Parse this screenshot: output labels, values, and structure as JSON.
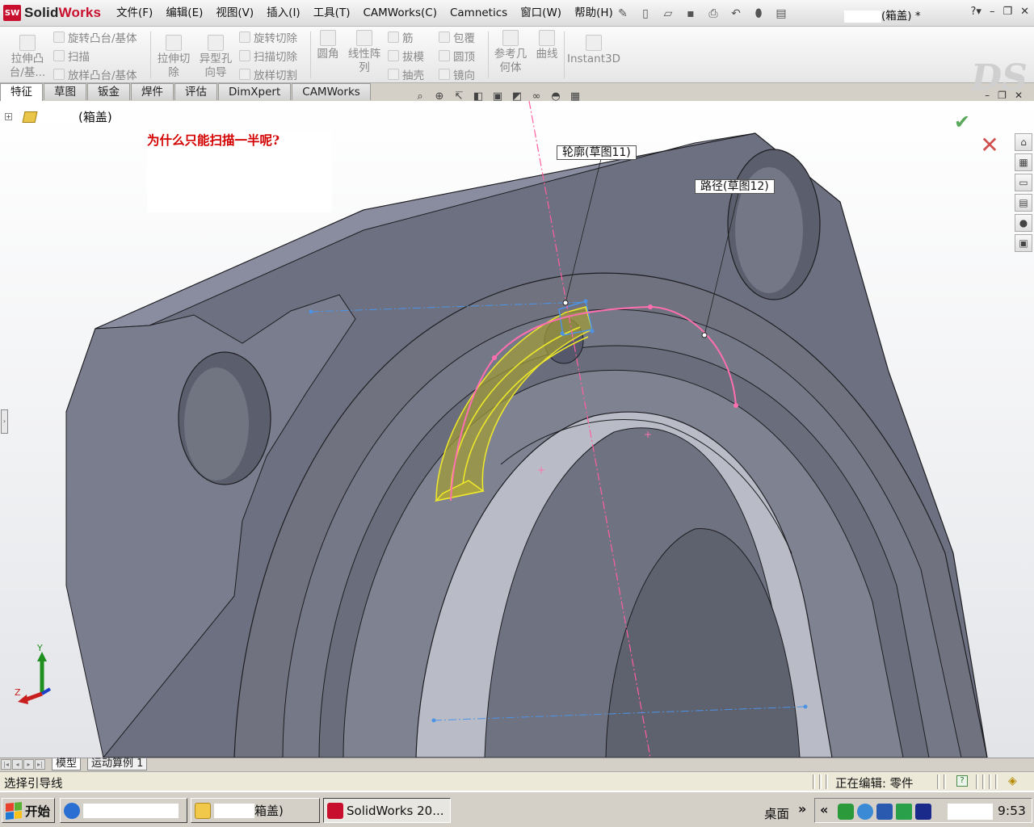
{
  "app": {
    "name": "SolidWorks",
    "doc_title_suffix": "(箱盖) *",
    "menus": [
      "文件(F)",
      "编辑(E)",
      "视图(V)",
      "插入(I)",
      "工具(T)",
      "CAMWorks(C)",
      "Camnetics",
      "窗口(W)",
      "帮助(H)"
    ]
  },
  "commands": {
    "extrude_boss": "拉伸凸台/基...",
    "revolve_boss": "旋转凸台/基体",
    "sweep": "扫描",
    "loft_boss": "放样凸台/基体",
    "extrude_cut": "拉伸切除",
    "hole_wizard": "异型孔向导",
    "revolve_cut": "旋转切除",
    "sweep_cut": "扫描切除",
    "loft_cut": "放样切割",
    "fillet": "圆角",
    "linear_pattern": "线性阵列",
    "rib": "筋",
    "draft": "拔模",
    "shell": "抽壳",
    "wrap": "包覆",
    "dome": "圆顶",
    "mirror": "镜向",
    "ref_geometry": "参考几何体",
    "curves": "曲线",
    "instant3d": "Instant3D"
  },
  "tabs": [
    "特征",
    "草图",
    "钣金",
    "焊件",
    "评估",
    "DimXpert",
    "CAMWorks"
  ],
  "active_tab": "特征",
  "feature_tree": {
    "root_label": "(箱盖)"
  },
  "annotation": {
    "note": "为什么只能扫描一半呢?"
  },
  "callouts": {
    "profile": "轮廓(草图11)",
    "path": "路径(草图12)"
  },
  "triad": {
    "y": "Y",
    "z": "Z"
  },
  "bottom_tabs": [
    "模型",
    "运动算例 1"
  ],
  "status": {
    "left": "选择引导线",
    "editing": "正在编辑: 零件"
  },
  "taskbar": {
    "start": "开始",
    "window2_suffix": "箱盖)",
    "window3": "SolidWorks 20...",
    "desktop": "桌面",
    "clock": "9:53"
  },
  "colors": {
    "model_face": "#6d7080",
    "sweep_preview": "#f0ea2a",
    "path_curve": "#ff6fb0",
    "axis_line": "#ff5f9f",
    "construction_line": "#4c93e6",
    "note_text": "#d40000"
  }
}
